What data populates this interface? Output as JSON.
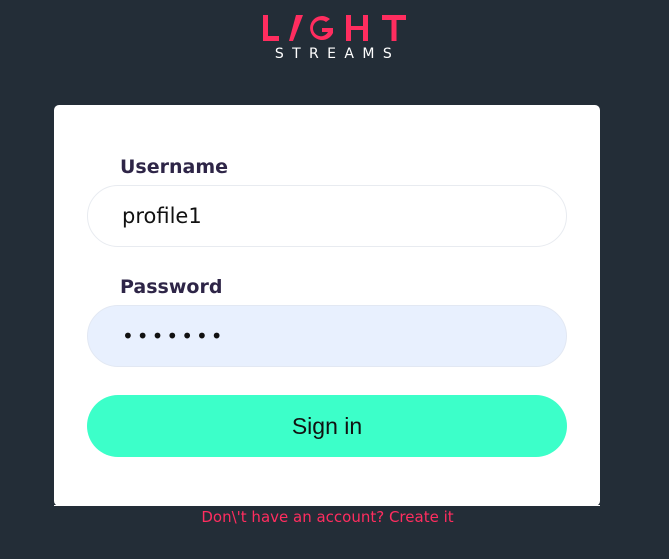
{
  "brand": {
    "name_top": "LIGHT",
    "name_bottom": "STREAMS",
    "accent_color": "#ff2d5f"
  },
  "form": {
    "username_label": "Username",
    "username_value": "profile1",
    "password_label": "Password",
    "password_value": "•••••••",
    "signin_label": "Sign in"
  },
  "footer": {
    "create_account_link": "Don\\'t have an account? Create it"
  },
  "colors": {
    "background": "#232d37",
    "button": "#3cffc9",
    "password_fill": "#e8f0fe"
  }
}
